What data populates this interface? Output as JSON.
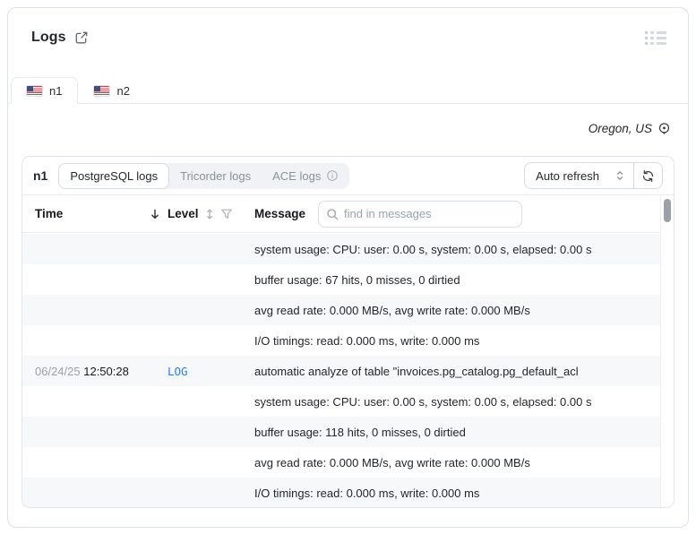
{
  "window": {
    "title": "Logs"
  },
  "tabs": [
    {
      "label": "n1",
      "flag": "us-flag"
    },
    {
      "label": "n2",
      "flag": "us-flag"
    }
  ],
  "region": {
    "label": "Oregon, US"
  },
  "toolbar": {
    "instance_label": "n1",
    "segments": [
      {
        "label": "PostgreSQL logs",
        "active": true
      },
      {
        "label": "Tricorder logs",
        "active": false
      },
      {
        "label": "ACE logs",
        "active": false,
        "has_info": true
      }
    ],
    "refresh_select": {
      "value": "Auto refresh"
    }
  },
  "table": {
    "columns": {
      "time": "Time",
      "level": "Level",
      "message": "Message"
    },
    "search": {
      "placeholder": "find in messages"
    },
    "rows": [
      {
        "date": "",
        "time": "",
        "level": "",
        "message": "system usage: CPU: user: 0.00 s, system: 0.00 s, elapsed: 0.00 s"
      },
      {
        "date": "",
        "time": "",
        "level": "",
        "message": "buffer usage: 67 hits, 0 misses, 0 dirtied"
      },
      {
        "date": "",
        "time": "",
        "level": "",
        "message": "avg read rate: 0.000 MB/s, avg write rate: 0.000 MB/s"
      },
      {
        "date": "",
        "time": "",
        "level": "",
        "message": "I/O timings: read: 0.000 ms, write: 0.000 ms"
      },
      {
        "date": "06/24/25",
        "time": "12:50:28",
        "level": "LOG",
        "message": "automatic analyze of table \"invoices.pg_catalog.pg_default_acl"
      },
      {
        "date": "",
        "time": "",
        "level": "",
        "message": "system usage: CPU: user: 0.00 s, system: 0.00 s, elapsed: 0.00 s"
      },
      {
        "date": "",
        "time": "",
        "level": "",
        "message": "buffer usage: 118 hits, 0 misses, 0 dirtied"
      },
      {
        "date": "",
        "time": "",
        "level": "",
        "message": "avg read rate: 0.000 MB/s, avg write rate: 0.000 MB/s"
      },
      {
        "date": "",
        "time": "",
        "level": "",
        "message": "I/O timings: read: 0.000 ms, write: 0.000 ms"
      }
    ]
  },
  "colors": {
    "accent_blue": "#2f80ed",
    "row_alt": "#f7f8fa",
    "border": "#e3e7ec",
    "muted_text": "#8a919b"
  }
}
